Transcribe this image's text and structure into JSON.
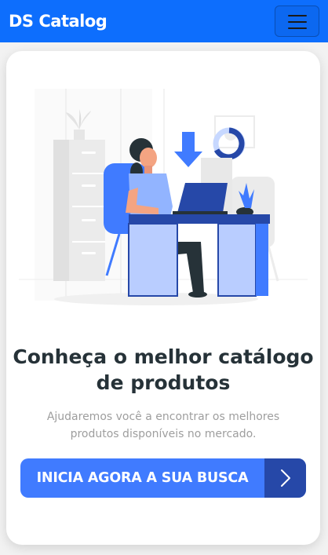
{
  "navbar": {
    "brand": "DS Catalog",
    "toggler_icon": "hamburger-menu-icon"
  },
  "hero": {
    "illustration": "person-working-at-desk-illustration",
    "title": "Conheça o melhor catálogo de produtos",
    "subtitle": "Ajudaremos você a encontrar os melhores produtos disponíveis no mercado.",
    "cta_label": "INICIA AGORA A SUA BUSCA",
    "cta_icon": "chevron-right-icon"
  },
  "colors": {
    "primary": "#0d6efd",
    "accent": "#407bff",
    "accent_dark": "#2648a8",
    "title": "#263238",
    "muted": "#9e9e9e"
  }
}
